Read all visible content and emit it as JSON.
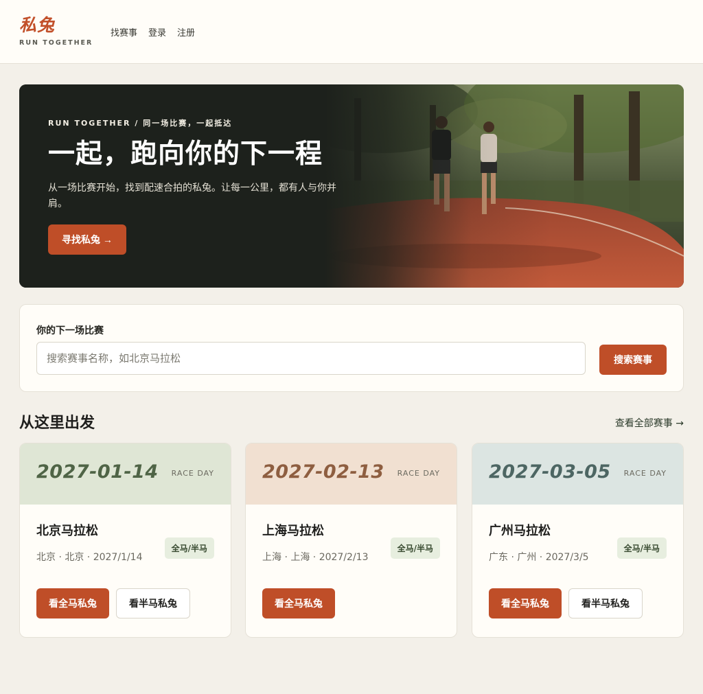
{
  "brand": {
    "logo": "私兔",
    "tagline": "RUN TOGETHER"
  },
  "nav": [
    "找赛事",
    "登录",
    "注册"
  ],
  "hero": {
    "kicker": "RUN TOGETHER / 同一场比赛，一起抵达",
    "title": "一起，跑向你的下一程",
    "description": "从一场比赛开始，找到配速合拍的私兔。让每一公里，都有人与你并肩。",
    "cta": "寻找私兔 →"
  },
  "search": {
    "label": "你的下一场比赛",
    "placeholder": "搜索赛事名称，如北京马拉松",
    "button": "搜索赛事"
  },
  "section": {
    "title": "从这里出发",
    "link": "查看全部赛事 →"
  },
  "races": [
    {
      "date": "2027-01-14",
      "tag": "RACE DAY",
      "name": "北京马拉松",
      "meta": "北京 · 北京 · 2027/1/14",
      "badge": "全马/半马",
      "primary": "看全马私兔",
      "secondary": "看半马私兔",
      "top_color": "#dfe6d5",
      "date_color": "#4f6446"
    },
    {
      "date": "2027-02-13",
      "tag": "RACE DAY",
      "name": "上海马拉松",
      "meta": "上海 · 上海 · 2027/2/13",
      "badge": "全马/半马",
      "primary": "看全马私兔",
      "secondary": "",
      "top_color": "#f1e0d1",
      "date_color": "#8e5e40"
    },
    {
      "date": "2027-03-05",
      "tag": "RACE DAY",
      "name": "广州马拉松",
      "meta": "广东 · 广州 · 2027/3/5",
      "badge": "全马/半马",
      "primary": "看全马私兔",
      "secondary": "看半马私兔",
      "top_color": "#dce5e2",
      "date_color": "#4d6663"
    }
  ],
  "colors": {
    "accent": "#bf4e28",
    "background": "#f3f0e9",
    "hero_bg": "#1d211c"
  }
}
